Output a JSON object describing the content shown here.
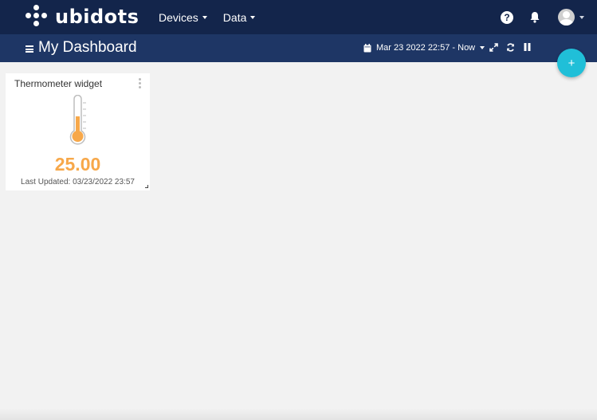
{
  "app": {
    "logo_text": "ubidots"
  },
  "nav": {
    "devices_label": "Devices",
    "data_label": "Data"
  },
  "header": {
    "title": "My Dashboard",
    "date_range": "Mar 23 2022 22:57 - Now"
  },
  "fab": {
    "label": "+"
  },
  "widget": {
    "title": "Thermometer widget",
    "value": "25.00",
    "last_updated": "Last Updated: 03/23/2022 23:57",
    "level": 0.5
  },
  "icons": {
    "help": "question-circle-icon",
    "notifications": "bell-icon",
    "avatar": "user-avatar-icon",
    "menu": "hamburger-menu-icon",
    "calendar": "calendar-icon",
    "expand": "expand-icon",
    "refresh": "refresh-icon",
    "pause": "pause-icon",
    "thermometer": "thermometer-icon"
  },
  "colors": {
    "navbar": "#13254b",
    "subbar": "#1e3665",
    "accent": "#20bfd8",
    "value": "#f7a84a",
    "background": "#f2f2f2"
  }
}
